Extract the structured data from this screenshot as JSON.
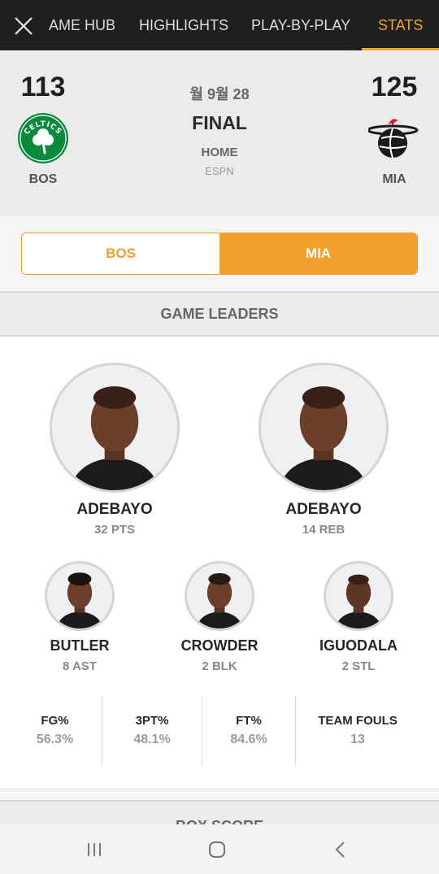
{
  "header": {
    "tabs": [
      "AME HUB",
      "HIGHLIGHTS",
      "PLAY-BY-PLAY",
      "STATS"
    ],
    "active_tab": "STATS",
    "close_icon": "close-icon"
  },
  "game": {
    "away": {
      "score": "113",
      "abbr": "BOS",
      "logo": "celtics-logo",
      "logo_text": "CELTICS",
      "color": "#0b8a3e"
    },
    "home": {
      "score": "125",
      "abbr": "MIA",
      "logo": "heat-logo"
    },
    "date": "월 9월 28",
    "status": "FINAL",
    "venue": "HOME",
    "network": "ESPN"
  },
  "team_toggle": {
    "left": "BOS",
    "right": "MIA",
    "selected": "MIA",
    "accent": "#f0a02f"
  },
  "leaders": {
    "title": "GAME LEADERS",
    "top": [
      {
        "name": "ADEBAYO",
        "stat": "32 PTS"
      },
      {
        "name": "ADEBAYO",
        "stat": "14 REB"
      }
    ],
    "bottom": [
      {
        "name": "BUTLER",
        "stat": "8 AST"
      },
      {
        "name": "CROWDER",
        "stat": "2 BLK"
      },
      {
        "name": "IGUODALA",
        "stat": "2 STL"
      }
    ]
  },
  "team_stats": [
    {
      "label": "FG%",
      "value": "56.3%"
    },
    {
      "label": "3PT%",
      "value": "48.1%"
    },
    {
      "label": "FT%",
      "value": "84.6%"
    },
    {
      "label": "TEAM FOULS",
      "value": "13"
    }
  ],
  "box_score_title": "BOX SCORE",
  "system_nav": [
    "recents-icon",
    "home-icon",
    "back-icon"
  ]
}
